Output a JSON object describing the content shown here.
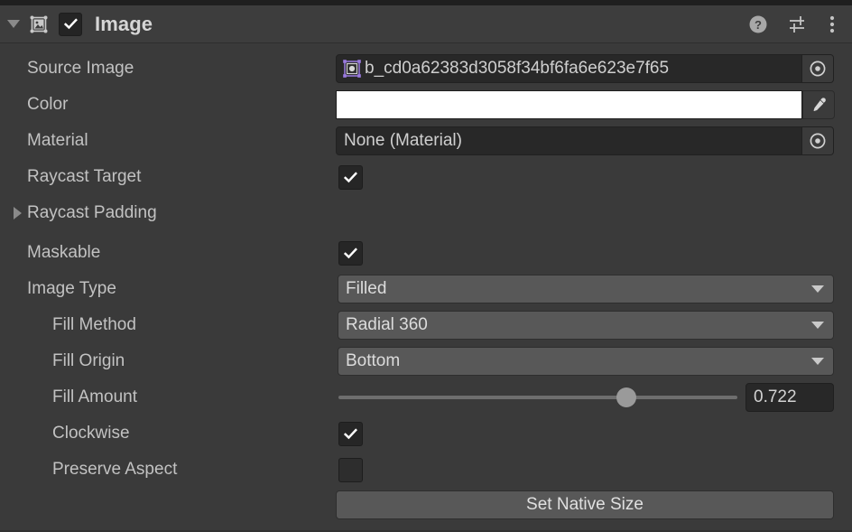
{
  "component": {
    "title": "Image",
    "enabled": true,
    "expanded": true,
    "icon": "image-component-icon",
    "header_buttons": [
      {
        "name": "help-icon",
        "glyph": "?"
      },
      {
        "name": "preset-icon",
        "glyph": "preset"
      },
      {
        "name": "more-menu-icon",
        "glyph": "⋮"
      }
    ]
  },
  "properties": {
    "source_image": {
      "label": "Source Image",
      "value": "b_cd0a62383d3058f34bf6fa6e623e7f65",
      "icon": "sprite-icon",
      "picker": "object-picker-icon"
    },
    "color": {
      "label": "Color",
      "value": "#FFFFFF",
      "eyedropper": "eyedropper-icon"
    },
    "material": {
      "label": "Material",
      "value": "None (Material)",
      "picker": "object-picker-icon"
    },
    "raycast_target": {
      "label": "Raycast Target",
      "checked": true
    },
    "raycast_padding": {
      "label": "Raycast Padding",
      "expanded": false
    },
    "maskable": {
      "label": "Maskable",
      "checked": true
    },
    "image_type": {
      "label": "Image Type",
      "value": "Filled"
    },
    "fill_method": {
      "label": "Fill Method",
      "value": "Radial 360"
    },
    "fill_origin": {
      "label": "Fill Origin",
      "value": "Bottom"
    },
    "fill_amount": {
      "label": "Fill Amount",
      "value": "0.722",
      "percent": 72.2,
      "min": 0,
      "max": 1
    },
    "clockwise": {
      "label": "Clockwise",
      "checked": true
    },
    "preserve_aspect": {
      "label": "Preserve Aspect",
      "checked": false
    },
    "set_native_size": {
      "label": "Set Native Size"
    }
  },
  "colors": {
    "panel_bg": "#3A3A3A",
    "header_bg": "#3D3D3D",
    "field_dark": "#282828",
    "dropdown_bg": "#585858",
    "text": "#C2C2C2",
    "sprite_accent": "#9B7BE0",
    "color_swatch": "#FFFFFF"
  }
}
